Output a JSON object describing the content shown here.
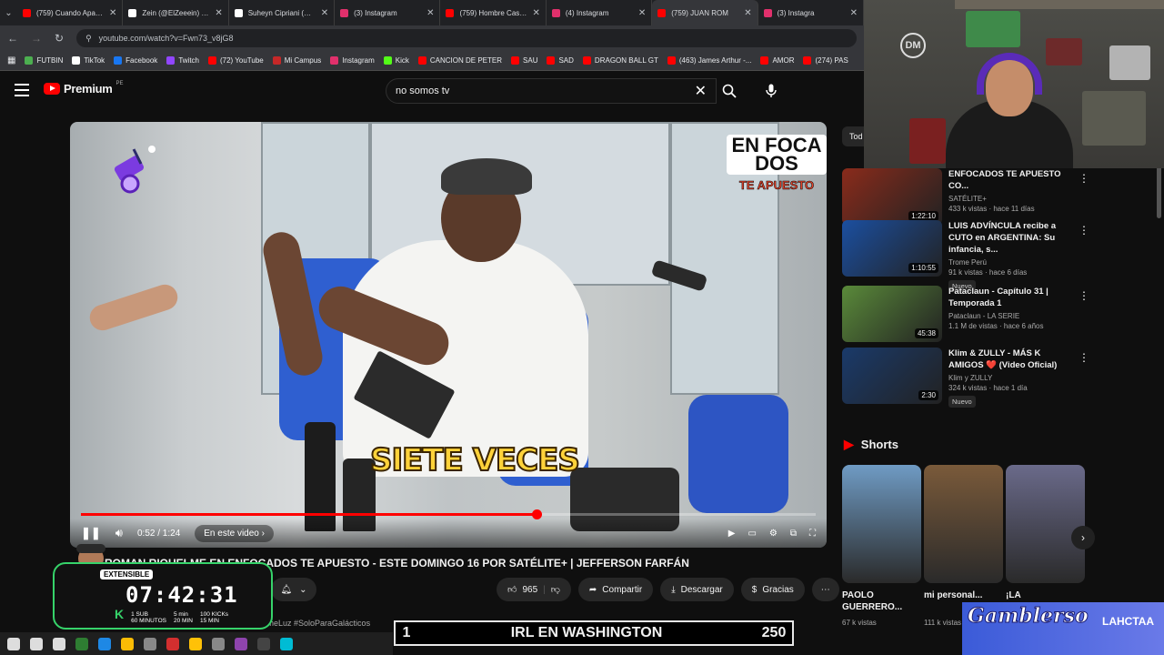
{
  "browser": {
    "tabs": [
      {
        "title": "(759) Cuando Aparez",
        "color": "#ff0000",
        "active": false
      },
      {
        "title": "Zein (@ElZeeein) / X",
        "color": "#ffffff",
        "active": false
      },
      {
        "title": "Suheyn Cipriani (@Ci",
        "color": "#ffffff",
        "active": false
      },
      {
        "title": "(3) Instagram",
        "color": "#e1306c",
        "active": false
      },
      {
        "title": "(759) Hombre Casad",
        "color": "#ff0000",
        "active": false
      },
      {
        "title": "(4) Instagram",
        "color": "#e1306c",
        "active": false
      },
      {
        "title": "(759) JUAN ROM",
        "color": "#ff0000",
        "active": true
      },
      {
        "title": "(3) Instagra",
        "color": "#e1306c",
        "active": false
      }
    ],
    "url": "youtube.com/watch?v=Fwn73_v8jG8",
    "bookmarks": [
      {
        "label": "FUTBIN",
        "color": "#4caf50"
      },
      {
        "label": "TikTok",
        "color": "#ffffff"
      },
      {
        "label": "Facebook",
        "color": "#1877f2"
      },
      {
        "label": "Twitch",
        "color": "#9146ff"
      },
      {
        "label": "(72) YouTube",
        "color": "#ff0000"
      },
      {
        "label": "Mi Campus",
        "color": "#c62828"
      },
      {
        "label": "Instagram",
        "color": "#e1306c"
      },
      {
        "label": "Kick",
        "color": "#53fc18"
      },
      {
        "label": "CANCION DE PETER",
        "color": "#ff0000"
      },
      {
        "label": "SAU",
        "color": "#ff0000"
      },
      {
        "label": "SAD",
        "color": "#ff0000"
      },
      {
        "label": "DRAGON BALL GT",
        "color": "#ff0000"
      },
      {
        "label": "(463) James Arthur -...",
        "color": "#ff0000"
      },
      {
        "label": "AMOR",
        "color": "#ff0000"
      },
      {
        "label": "(274) PAS",
        "color": "#ff0000"
      }
    ]
  },
  "youtube": {
    "brand": "Premium",
    "country": "PE",
    "search_value": "no somos tv"
  },
  "video": {
    "subtitle": "SIETE VECES",
    "logo_line1": "EN FOCA DOS",
    "logo_line2": "TE APUESTO",
    "time": "0:52 / 1:24",
    "chapter": "En este video",
    "progress": 0.62,
    "title": "ROMAN RIQUELME EN ENFOCADOS TE APUESTO - ESTE DOMINGO 16 POR SATÉLITE+ | JEFFERSON FARFÁN",
    "likes": "965",
    "share": "Compartir",
    "download": "Descargar",
    "thanks": "Gracias",
    "desc": "DameLuz #SoloParaGalácticos"
  },
  "sidebar": {
    "chip": "Tod",
    "recommendations": [
      {
        "title": "ENFOCADOS TE APUESTO CO...",
        "channel": "SATÉLITE+",
        "meta": "433 k vistas · hace 11 días",
        "duration": "1:22:10",
        "new": false,
        "thumb": "#8a2b1b"
      },
      {
        "title": "LUIS ADVÍNCULA recibe a CUTO en ARGENTINA: Su infancia, s...",
        "channel": "Trome Perú",
        "meta": "91 k vistas · hace 6 días",
        "duration": "1:10:55",
        "new": true,
        "thumb": "#1b4fa0"
      },
      {
        "title": "Pataclaun - Capítulo 31 | Temporada 1",
        "channel": "Pataclaun - LA SERIE",
        "meta": "1.1 M de vistas · hace 6 años",
        "duration": "45:38",
        "new": false,
        "thumb": "#5a8a3a"
      },
      {
        "title": "Klim & ZULLY - MÁS K AMIGOS ❤️ (Video Oficial)",
        "channel": "Klim y ZULLY",
        "meta": "324 k vistas · hace 1 día",
        "duration": "2:30",
        "new": true,
        "thumb": "#1a3a6a"
      }
    ],
    "new_label": "Nuevo",
    "shorts_label": "Shorts",
    "shorts": [
      {
        "title": "PAOLO GUERRERO...",
        "views": "67 k vistas",
        "color": "#6f9bc4"
      },
      {
        "title": "mi personal...",
        "views": "111 k vistas",
        "color": "#7a5a3a"
      },
      {
        "title": "¡LA",
        "views": "",
        "color": "#6a6a8a"
      }
    ]
  },
  "overlays": {
    "clock_sub": "EXTENSIBLE",
    "clock_time": "07:42:31",
    "clock_row1": "1 SUB",
    "clock_row1b": "60 MINUTOS",
    "clock_row2": "5 min",
    "clock_row2b": "20 MIN",
    "clock_row3": "100 KICKs",
    "clock_row3b": "15 MIN",
    "irl_left": "1",
    "irl_title": "IRL EN WASHINGTON",
    "irl_right": "250",
    "graffiti_a": "Gamblerso",
    "graffiti_b": "LAHCTAA"
  },
  "taskbar_icons": [
    "#ffffff",
    "#ffffff",
    "#ffffff",
    "#2e7d32",
    "#1e88e5",
    "#fbbc05",
    "#888888",
    "#d32f2f",
    "#ffc107",
    "#888888",
    "#8e44ad",
    "#444444",
    "#00bcd4"
  ]
}
